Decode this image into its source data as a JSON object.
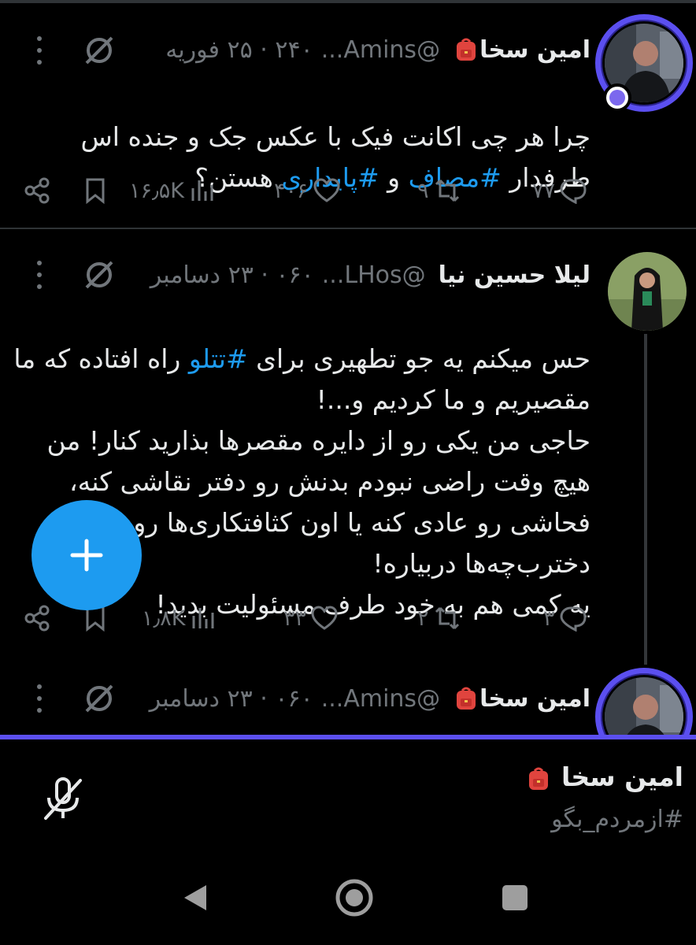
{
  "tweets": [
    {
      "display_name": "امین سخا",
      "handle": "@Amins...",
      "meta": "۲۴۰ · ۲۵ فوریه",
      "text_parts": [
        "چرا هر چی اکانت فیک با عکس جک و جنده اس\nطرفدار ",
        "#مصاف",
        " و ",
        "#پایداری",
        " هستن؟"
      ],
      "replies": "۷۷",
      "retweets": "۹",
      "likes": "۴۰۶",
      "views": "۱۶٫۵K"
    },
    {
      "display_name": "لیلا حسین نیا",
      "handle": "@LHos...",
      "meta": "۰۶۰ · ۲۳ دسامبر",
      "text_parts": [
        "حس میکنم یه جو تطهیری برای ",
        "#تتلو",
        " راه افتاده که ما\nمقصیریم و ما کردیم و...!\nحاجی من یکی رو از دایره مقصرها بذارید کنار! من\nهیچ وقت راضی نبودم بدنش رو دفتر نقاشی کنه،\nفحاشی رو عادی کنه یا اون کثافتکاری‌ها رو سر\nدخترب‌چه‌ها دربیاره!\nیه کمی هم به خود طرف مسئولیت بدید!"
      ],
      "replies": "۳",
      "retweets": "۲",
      "likes": "۳۳",
      "views": "۱٫۸K"
    },
    {
      "display_name": "امین سخا",
      "handle": "@Amins...",
      "meta": "۰۶۰ · ۲۳ دسامبر"
    }
  ],
  "space": {
    "host_name": "امین سخا",
    "title": "#ازمردم_بگو"
  },
  "icons": {
    "reply": "reply-icon",
    "retweet": "retweet-icon",
    "like": "heart-icon",
    "views": "views-icon",
    "bookmark": "bookmark-icon",
    "share": "share-icon",
    "mute": "mute-icon",
    "more": "more-icon",
    "compose": "compose-plus-icon",
    "mic_off": "mic-off-icon",
    "back": "back-icon",
    "home": "home-icon",
    "recents": "recents-icon",
    "emoji": "backpack-emoji"
  },
  "colors": {
    "background": "#000000",
    "accent": "#1d9bf0",
    "space_purple": "#5b4ff0",
    "muted_text": "#71767b"
  }
}
